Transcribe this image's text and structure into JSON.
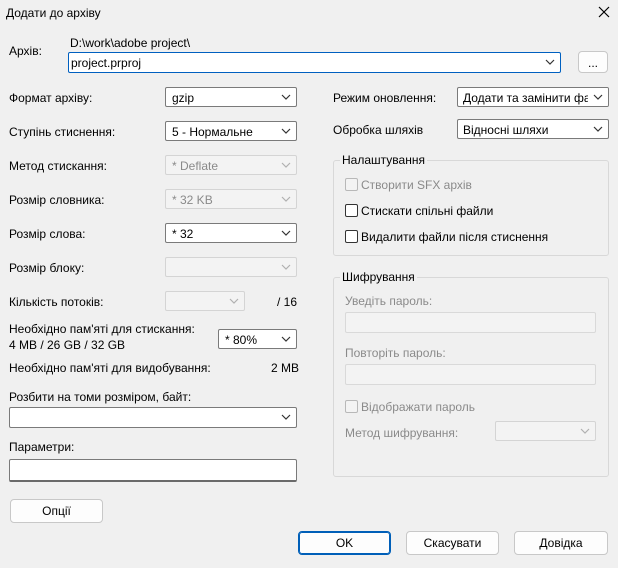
{
  "window": {
    "title": "Додати до архіву"
  },
  "archive": {
    "label": "Архів:",
    "path": "D:\\work\\adobe project\\",
    "filename": "project.prproj",
    "browse_label": "..."
  },
  "left": {
    "format": {
      "label": "Формат архіву:",
      "value": "gzip"
    },
    "level": {
      "label": "Ступінь стиснення:",
      "value": "5 - Нормальне"
    },
    "method": {
      "label": "Метод стискання:",
      "value": "* Deflate"
    },
    "dict": {
      "label": "Розмір словника:",
      "value": "* 32 KB"
    },
    "word": {
      "label": "Розмір слова:",
      "value": "* 32"
    },
    "block": {
      "label": "Розмір блоку:",
      "value": ""
    },
    "threads": {
      "label": "Кількість потоків:",
      "value": "",
      "max": "/ 16"
    },
    "mem_compress": {
      "label": "Необхідно пам'яті для стискання:",
      "value": "4 MB / 26 GB / 32 GB",
      "percent": "* 80%"
    },
    "mem_decompress": {
      "label": "Необхідно пам'яті для видобування:",
      "value": "2 MB"
    },
    "split": {
      "label": "Розбити на томи розміром, байт:",
      "value": ""
    },
    "params": {
      "label": "Параметри:",
      "value": ""
    },
    "options_button": "Опції"
  },
  "right": {
    "update_mode": {
      "label": "Режим оновлення:",
      "value": "Додати та замінити файл"
    },
    "path_mode": {
      "label": "Обробка шляхів",
      "value": "Відносні шляхи"
    },
    "settings": {
      "title": "Налаштування",
      "sfx": "Створити SFX архів",
      "shared": "Стискати спільні файли",
      "delete_after": "Видалити файли після стиснення"
    },
    "encryption": {
      "title": "Шифрування",
      "enter_password": "Уведіть пароль:",
      "repeat_password": "Повторіть пароль:",
      "show_password": "Відображати пароль",
      "method_label": "Метод шифрування:",
      "method_value": ""
    }
  },
  "buttons": {
    "ok": "OK",
    "cancel": "Скасувати",
    "help": "Довідка"
  }
}
